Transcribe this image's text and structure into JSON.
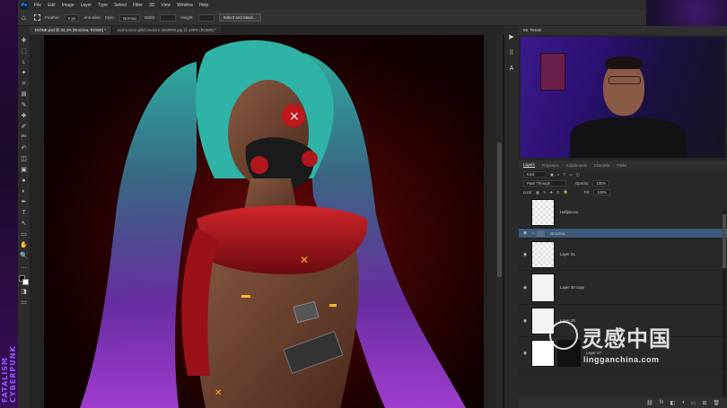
{
  "menubar": {
    "app_icon": "Ps",
    "items": [
      "File",
      "Edit",
      "Image",
      "Layer",
      "Type",
      "Select",
      "Filter",
      "3D",
      "View",
      "Window",
      "Help"
    ]
  },
  "options": {
    "feather_label": "Feather:",
    "feather_value": "0 px",
    "antialias_label": "Anti-alias",
    "style_label": "Style:",
    "style_value": "Normal",
    "width_label": "Width:",
    "height_label": "Height:",
    "select_mask_button": "Select and Mask..."
  },
  "tabs": [
    {
      "label": "DIONE.psd @ 33,3% (Bronzea, RGB/8) *",
      "active": true
    },
    {
      "label": "tool-screen-glitch-texture-4669905.jpg @ 100% (RGB/8) *",
      "active": false
    }
  ],
  "toolbar": {
    "tools": [
      "move-icon",
      "marquee-icon",
      "lasso-icon",
      "magic-wand-icon",
      "crop-icon",
      "frame-icon",
      "eyedropper-icon",
      "healing-icon",
      "brush-icon",
      "stamp-icon",
      "history-brush-icon",
      "eraser-icon",
      "gradient-icon",
      "blur-icon",
      "dodge-icon",
      "pen-icon",
      "type-icon",
      "path-select-icon",
      "shape-icon",
      "hand-icon",
      "zoom-icon",
      "more-icon"
    ],
    "glyphs": [
      "✥",
      "⬚",
      "ʟ",
      "✦",
      "⌗",
      "⊠",
      "✎",
      "✚",
      "✐",
      "⎃",
      "↶",
      "◫",
      "▣",
      "●",
      "◐",
      "✒",
      "T",
      "↖",
      "▭",
      "✋",
      "🔍",
      "…"
    ]
  },
  "side_strip": {
    "glyphs": [
      "▶",
      "⠿",
      "A"
    ]
  },
  "webcam": {
    "title": "Mr. Tessin"
  },
  "layers": {
    "tabs": [
      "Layers",
      "Properties",
      "Adjustments",
      "Channels",
      "Paths"
    ],
    "filter_kind": "Kind",
    "blend_mode": "Pass Through",
    "opacity_label": "Opacity:",
    "opacity_value": "100%",
    "lock_label": "Lock:",
    "fill_label": "Fill:",
    "fill_value": "100%",
    "items": [
      {
        "name": "Halfpieces",
        "visible": false,
        "selected": false,
        "group": false
      },
      {
        "name": "Bronzea",
        "visible": true,
        "selected": true,
        "group": true
      },
      {
        "name": "Layer 31",
        "visible": true,
        "selected": false,
        "group": false
      },
      {
        "name": "Layer 30 copy",
        "visible": true,
        "selected": false,
        "group": false
      },
      {
        "name": "Layer 28",
        "visible": true,
        "selected": false,
        "group": false
      },
      {
        "name": "Layer 27",
        "visible": true,
        "selected": false,
        "group": false
      }
    ],
    "bottom_icons": [
      "link-icon",
      "fx-icon",
      "mask-icon",
      "adjustment-icon",
      "group-icon",
      "new-layer-icon",
      "delete-icon"
    ],
    "bottom_glyphs": [
      "⛓",
      "fx",
      "◧",
      "◑",
      "▭",
      "⊞",
      "🗑"
    ]
  },
  "watermark": {
    "cn": "灵感中国",
    "url": "lingganchina.com"
  },
  "brand": {
    "vertical_top": "FATALISM",
    "vertical_bottom": "CYBERPUNK"
  },
  "colors": {
    "accent_blue": "#31a8ff",
    "selected_layer": "#3e5a7a",
    "hair": "#2fb3a6",
    "hair_purple": "#8b3fbf",
    "suit_red": "#b0161c",
    "skin": "#6b3e2a"
  }
}
